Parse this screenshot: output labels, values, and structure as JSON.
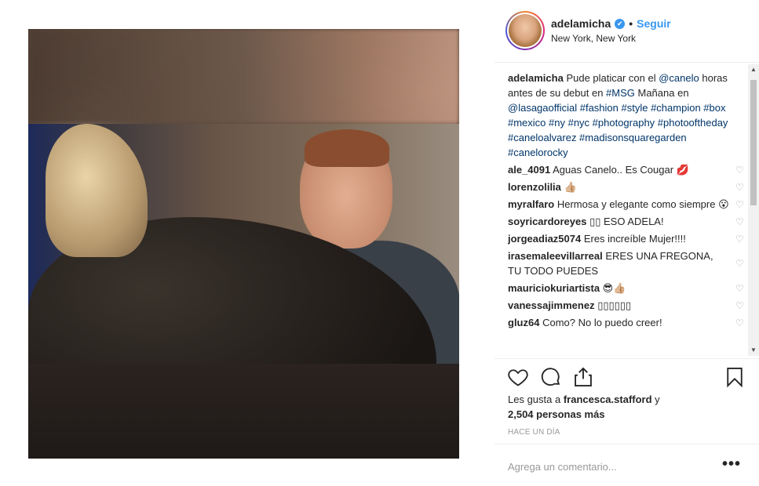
{
  "post": {
    "username": "adelamicha",
    "follow_label": "Seguir",
    "separator": "•",
    "location": "New York, New York",
    "caption_text_1": " Pude platicar con el ",
    "mention_1": "@canelo",
    "caption_text_2": " horas antes de su debut en ",
    "tag_msg": "#MSG",
    "caption_text_3": " Mañana en ",
    "mention_2": "@lasagaofficial",
    "tags_rest": " #fashion #style #champion #box #mexico #ny #nyc #photography #photooftheday #caneloalvarez #madisonsquaregarden #canelorocky"
  },
  "comments": [
    {
      "user": "ale_4091",
      "text": " Aguas Canelo.. Es Cougar 💋"
    },
    {
      "user": "lorenzolilia",
      "text": " 👍🏼"
    },
    {
      "user": "myralfaro",
      "text": " Hermosa y elegante como siempre 😮"
    },
    {
      "user": "soyricardoreyes",
      "text": " ▯▯ ESO ADELA!"
    },
    {
      "user": "jorgeadiaz5074",
      "text": " Eres increíble Mujer!!!!"
    },
    {
      "user": "irasemaleevillarreal",
      "text": " ERES UNA FREGONA, TU TODO PUEDES"
    },
    {
      "user": "mauriciokuriartista",
      "text": " 😎👍🏼"
    },
    {
      "user": "vanessajimmenez",
      "text": " ▯▯▯▯▯▯"
    },
    {
      "user": "gluz64",
      "text": " Como? No lo puedo creer!"
    }
  ],
  "likes": {
    "prefix": "Les gusta a ",
    "user": "francesca.stafford",
    "connector": " y",
    "count": "2,504 personas más"
  },
  "time_label": "HACE UN DÍA",
  "add_comment_placeholder": "Agrega un comentario...",
  "more_label": "•••",
  "icons": [
    "heart-icon",
    "comment-icon",
    "share-icon",
    "bookmark-icon"
  ]
}
